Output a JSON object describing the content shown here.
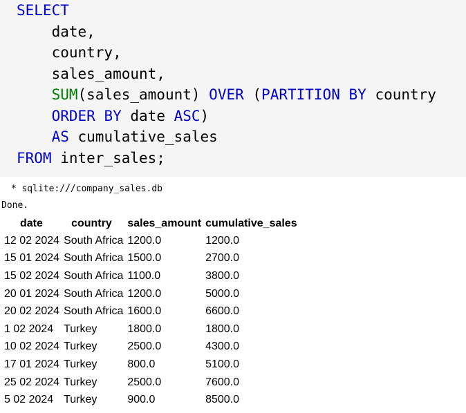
{
  "code_cell": {
    "lines": [
      [
        {
          "t": "SELECT",
          "c": "kw"
        }
      ],
      [
        {
          "t": "    date,",
          "c": ""
        }
      ],
      [
        {
          "t": "    country,",
          "c": ""
        }
      ],
      [
        {
          "t": "    sales_amount,",
          "c": ""
        }
      ],
      [
        {
          "t": "    ",
          "c": ""
        },
        {
          "t": "SUM",
          "c": "fn"
        },
        {
          "t": "(sales_amount) ",
          "c": ""
        },
        {
          "t": "OVER",
          "c": "kw"
        },
        {
          "t": " (",
          "c": ""
        },
        {
          "t": "PARTITION",
          "c": "kw"
        },
        {
          "t": " ",
          "c": ""
        },
        {
          "t": "BY",
          "c": "kw"
        },
        {
          "t": " country",
          "c": ""
        }
      ],
      [
        {
          "t": "    ",
          "c": ""
        },
        {
          "t": "ORDER",
          "c": "kw"
        },
        {
          "t": " ",
          "c": ""
        },
        {
          "t": "BY",
          "c": "kw"
        },
        {
          "t": " date ",
          "c": ""
        },
        {
          "t": "ASC",
          "c": "kw"
        },
        {
          "t": ")",
          "c": ""
        }
      ],
      [
        {
          "t": "    ",
          "c": ""
        },
        {
          "t": "AS",
          "c": "kw"
        },
        {
          "t": " cumulative_sales",
          "c": ""
        }
      ],
      [
        {
          "t": "FROM",
          "c": "kw"
        },
        {
          "t": " inter_sales;",
          "c": ""
        }
      ]
    ]
  },
  "output": {
    "connection": " * sqlite:///company_sales.db",
    "status": "Done.",
    "columns": [
      "date",
      "country",
      "sales_amount",
      "cumulative_sales"
    ],
    "rows": [
      [
        "12 02 2024",
        "South Africa",
        "1200.0",
        "1200.0"
      ],
      [
        "15 01 2024",
        "South Africa",
        "1500.0",
        "2700.0"
      ],
      [
        "15 02 2024",
        "South Africa",
        "1100.0",
        "3800.0"
      ],
      [
        "20 01 2024",
        "South Africa",
        "1200.0",
        "5000.0"
      ],
      [
        "20 02 2024",
        "South Africa",
        "1600.0",
        "6600.0"
      ],
      [
        "1 02 2024",
        "Turkey",
        "1800.0",
        "1800.0"
      ],
      [
        "10 02 2024",
        "Turkey",
        "2500.0",
        "4300.0"
      ],
      [
        "17 01 2024",
        "Turkey",
        "800.0",
        "5100.0"
      ],
      [
        "25 02 2024",
        "Turkey",
        "2500.0",
        "7600.0"
      ],
      [
        "5 02 2024",
        "Turkey",
        "900.0",
        "8500.0"
      ]
    ]
  },
  "colors": {
    "keyword": "#0000cc",
    "function": "#008000",
    "code_background": "#f5f5f5"
  }
}
